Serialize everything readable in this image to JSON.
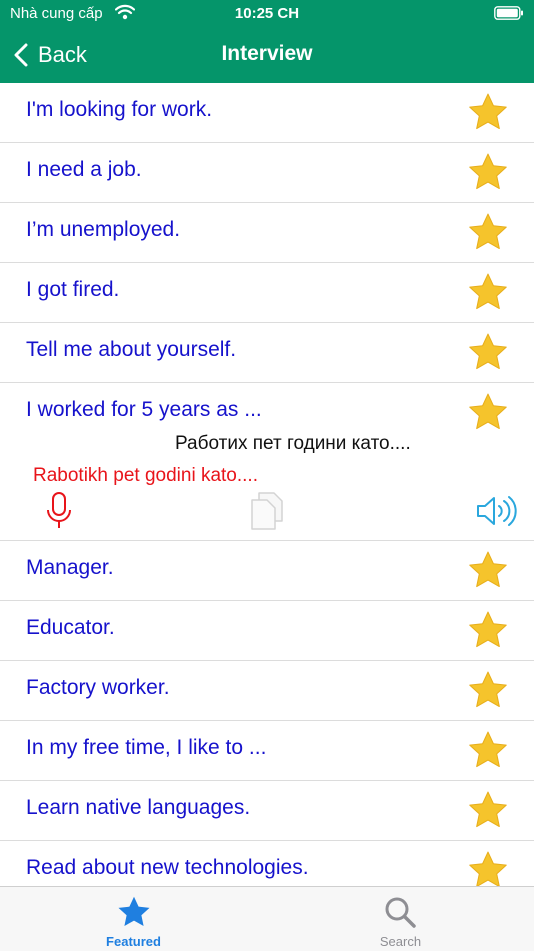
{
  "status_bar": {
    "carrier": "Nhà cung cấp",
    "time": "10:25 CH"
  },
  "nav": {
    "back_label": "Back",
    "title": "Interview"
  },
  "colors": {
    "header": "#05956a",
    "phrase_text": "#1612cc",
    "romanization": "#e8141a",
    "star": "#f5c42c",
    "accent": "#1f7fe0",
    "speaker": "#2aa7dd"
  },
  "phrases_top": [
    {
      "text": "I'm looking for work.",
      "favorite": true
    },
    {
      "text": "I need a job.",
      "favorite": true
    },
    {
      "text": "I’m unemployed.",
      "favorite": true
    },
    {
      "text": "I got fired.",
      "favorite": true
    },
    {
      "text": "Tell me about yourself.",
      "favorite": true
    }
  ],
  "expanded": {
    "text": "I worked for 5 years as ...",
    "favorite": true,
    "translation": "Работих пет години като....",
    "romanization": "Rabotikh pet godini kato....",
    "icons": [
      "microphone-icon",
      "copy-icon",
      "speaker-icon"
    ]
  },
  "phrases_bottom": [
    {
      "text": "Manager.",
      "favorite": true
    },
    {
      "text": "Educator.",
      "favorite": true
    },
    {
      "text": "Factory worker.",
      "favorite": true
    },
    {
      "text": "In my free time, I like to ...",
      "favorite": true
    },
    {
      "text": "Learn native languages.",
      "favorite": true
    },
    {
      "text": "Read about new technologies.",
      "favorite": true
    }
  ],
  "tabs": [
    {
      "label": "Featured",
      "icon": "star-icon",
      "selected": true
    },
    {
      "label": "Search",
      "icon": "search-icon",
      "selected": false
    }
  ]
}
